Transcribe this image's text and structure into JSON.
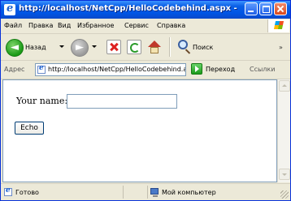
{
  "window": {
    "title": "http://localhost/NetCpp/HelloCodebehind.aspx -"
  },
  "menu": {
    "items": [
      "Файл",
      "Правка",
      "Вид",
      "Избранное",
      "Сервис",
      "Справка"
    ]
  },
  "toolbar": {
    "back_label": "Назад",
    "search_label": "Поиск"
  },
  "address": {
    "label": "Адрес",
    "url": "http://localhost/NetCpp/HelloCodebehind.aspx",
    "go_label": "Переход",
    "links_label": "Ссылки"
  },
  "page": {
    "name_label": "Your name:",
    "name_value": "",
    "hello_button": "Echo"
  },
  "status": {
    "text": "Готово",
    "zone": "Мой компьютер"
  },
  "colors": {
    "titlebar": "#0055e5",
    "chrome": "#ece9d8",
    "border": "#7f9db9"
  }
}
